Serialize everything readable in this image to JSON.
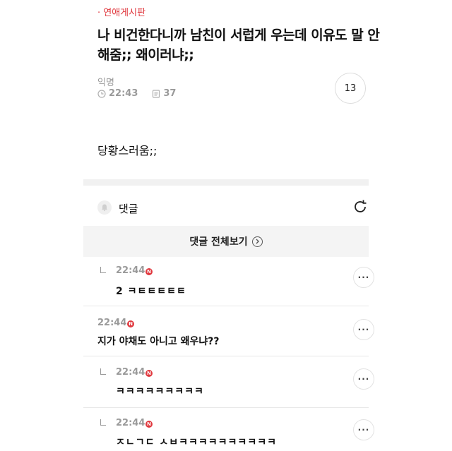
{
  "post": {
    "board": "· 연애게시판",
    "title": "나 비건한다니까 남친이 서럽게 우는데 이유도 말 안해줌;; 왜이러냐;;",
    "author": "익명",
    "time": "22:43",
    "views": "37",
    "comment_count": "13",
    "body": "당황스러움;;"
  },
  "comments_section": {
    "label": "댓글",
    "view_all": "댓글 전체보기"
  },
  "comments": [
    {
      "time": "22:44",
      "badge": "N",
      "text": "2 ㅋㅌㅌㅌㅌㅌ",
      "reply": true,
      "more": "···"
    },
    {
      "time": "22:44",
      "badge": "N",
      "text": "지가 야채도 아니고 왜우냐??",
      "reply": false,
      "more": "···"
    },
    {
      "time": "22:44",
      "badge": "N",
      "text": "ㅋㅋㅋㅋㅋㅋㅋㅋㅋ",
      "reply": true,
      "more": "···"
    },
    {
      "time": "22:44",
      "badge": "N",
      "text": "ㅈㄴㄱㄷ ㅅㅂㅋㅋㅋㅋㅋㅋㅋㅋㅋㅋ",
      "reply": true,
      "more": "···"
    }
  ]
}
